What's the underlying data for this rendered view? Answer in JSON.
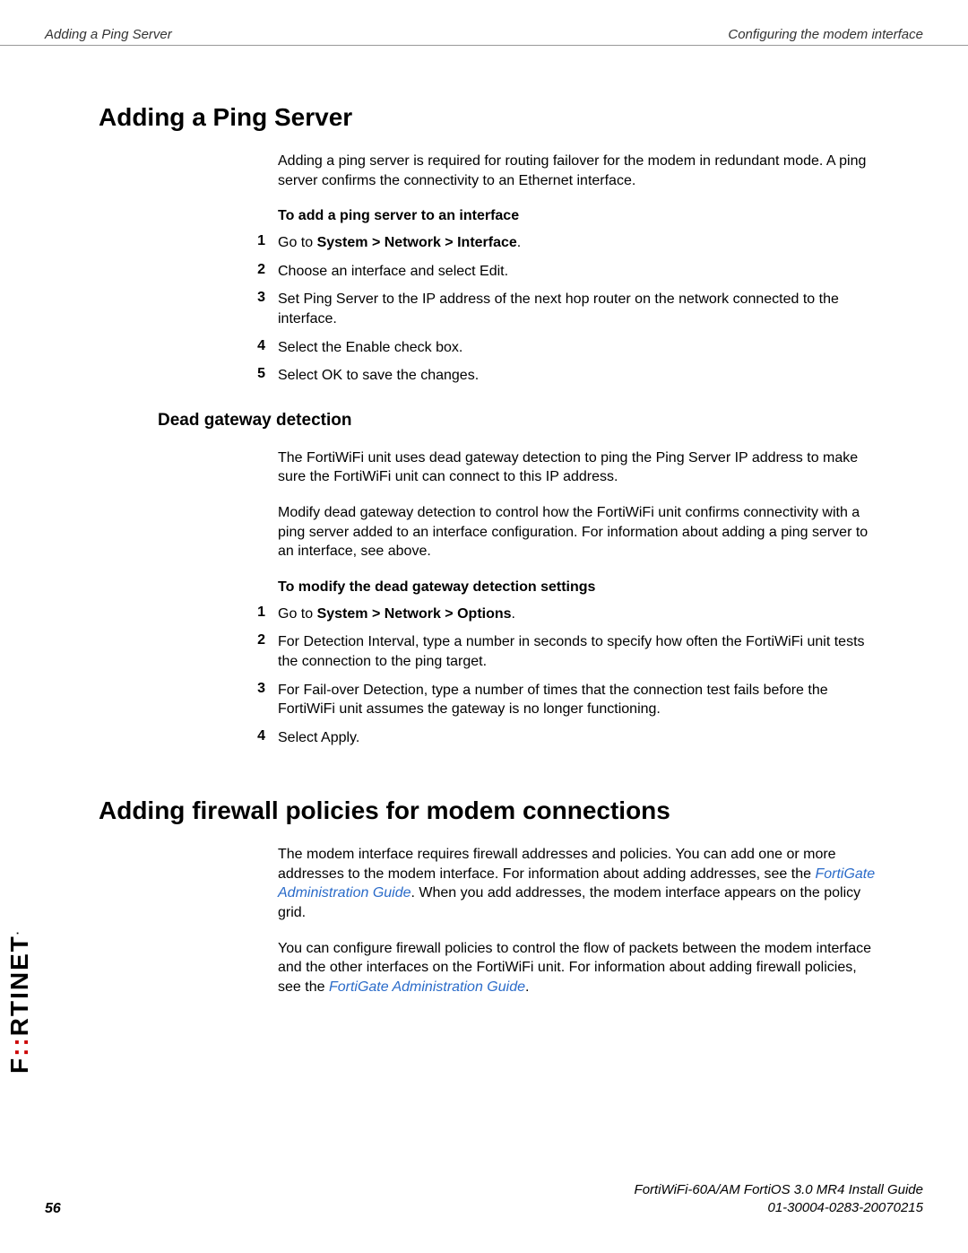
{
  "header": {
    "left": "Adding a Ping Server",
    "right": "Configuring the modem interface"
  },
  "section1": {
    "title": "Adding a Ping Server",
    "intro": "Adding a ping server is required for routing failover for the modem in redundant mode. A ping server confirms the connectivity to an Ethernet interface.",
    "proc_title": "To add a ping server to an interface",
    "steps": {
      "s1_prefix": "Go to ",
      "s1_bold": "System > Network > Interface",
      "s1_suffix": ".",
      "s2": "Choose an interface and select Edit.",
      "s3": "Set Ping Server to the IP address of the next hop router on the network connected to the interface.",
      "s4": "Select the Enable check box.",
      "s5": "Select OK to save the changes."
    },
    "sub_title": "Dead gateway detection",
    "sub_para1": "The FortiWiFi unit uses dead gateway detection to ping the Ping Server IP address to make sure the FortiWiFi unit can connect to this IP address.",
    "sub_para2": "Modify dead gateway detection to control how the FortiWiFi unit confirms connectivity with a ping server added to an interface configuration. For information about adding a ping server to an interface, see above.",
    "proc2_title": "To modify the dead gateway detection settings",
    "steps2": {
      "s1_prefix": "Go to ",
      "s1_bold": "System > Network > Options",
      "s1_suffix": ".",
      "s2": "For Detection Interval, type a number in seconds to specify how often the FortiWiFi unit tests the connection to the ping target.",
      "s3": "For Fail-over Detection, type a number of times that the connection test fails before the FortiWiFi unit assumes the gateway is no longer functioning.",
      "s4": "Select Apply."
    }
  },
  "section2": {
    "title": "Adding firewall policies for modem connections",
    "para1_a": "The modem interface requires firewall addresses and policies. You can add one or more addresses to the modem interface. For information about adding addresses, see the ",
    "para1_link": "FortiGate Administration Guide",
    "para1_b": ". When you add addresses, the modem interface appears on the policy grid.",
    "para2_a": "You can configure firewall policies to control the flow of packets between the modem interface and the other interfaces on the FortiWiFi unit. For information about adding firewall policies, see the ",
    "para2_link": "FortiGate Administration Guide",
    "para2_b": "."
  },
  "logo": {
    "brand": "F",
    "brand2": "RTINET"
  },
  "footer": {
    "page_num": "56",
    "doc_title": "FortiWiFi-60A/AM FortiOS 3.0 MR4 Install Guide",
    "doc_id": "01-30004-0283-20070215"
  },
  "nums": {
    "n1": "1",
    "n2": "2",
    "n3": "3",
    "n4": "4",
    "n5": "5"
  }
}
